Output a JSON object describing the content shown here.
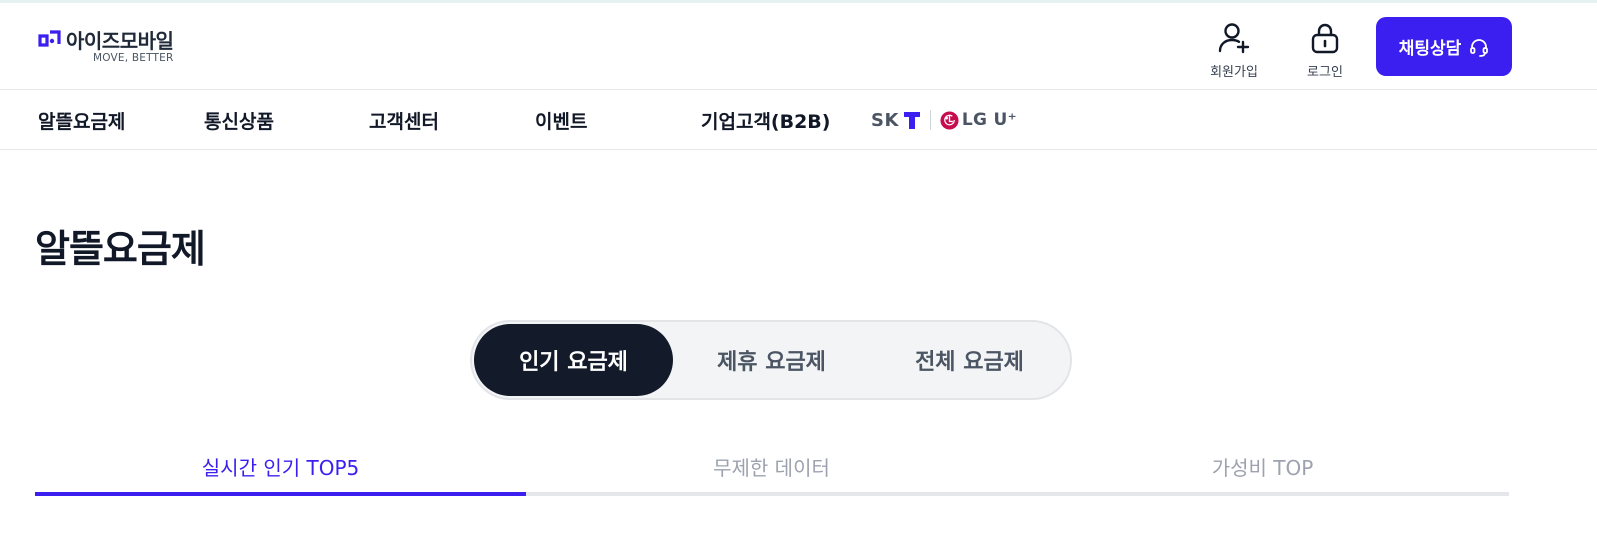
{
  "header": {
    "logo": {
      "name": "아이즈모바일",
      "tagline": "MOVE, BETTER"
    },
    "actions": [
      {
        "label": "회원가입",
        "icon": "user-plus-icon"
      },
      {
        "label": "로그인",
        "icon": "lock-icon"
      }
    ],
    "chat_button": {
      "label": "채팅상담",
      "icon": "headset-icon"
    }
  },
  "nav": {
    "items": [
      "알뜰요금제",
      "통신상품",
      "고객센터",
      "이벤트",
      "기업고객(B2B)"
    ],
    "carriers": {
      "sk": "SK",
      "lg": "LG U⁺"
    }
  },
  "main": {
    "title": "알뜰요금제",
    "segments": [
      {
        "label": "인기 요금제",
        "active": true
      },
      {
        "label": "제휴 요금제",
        "active": false
      },
      {
        "label": "전체 요금제",
        "active": false
      }
    ],
    "tabs": [
      {
        "label": "실시간 인기 TOP5",
        "active": true
      },
      {
        "label": "무제한 데이터",
        "active": false
      },
      {
        "label": "가성비 TOP",
        "active": false
      }
    ]
  },
  "colors": {
    "brand": "#3a1ff0",
    "segment_active": "#131a29",
    "lg_red": "#c50d4f"
  }
}
